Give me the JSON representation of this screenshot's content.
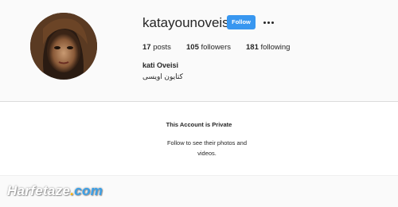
{
  "profile": {
    "username": "katayounoveisi",
    "follow_label": "Follow",
    "more_icon": "more-horizontal-icon",
    "stats": {
      "posts_count": "17",
      "posts_label": "posts",
      "followers_count": "105",
      "followers_label": "followers",
      "following_count": "181",
      "following_label": "following"
    },
    "full_name": "kati Oveisi",
    "bio": "کتایون اویسی"
  },
  "private_notice": {
    "title": "This Account is Private",
    "message": "Follow to see their photos and videos."
  },
  "watermark": {
    "name": "Harfetaze",
    "dot": ".",
    "tld": "com"
  },
  "colors": {
    "follow_button": "#3897f0",
    "background": "#fafafa",
    "panel": "#ffffff",
    "divider": "#dbdbdb"
  }
}
